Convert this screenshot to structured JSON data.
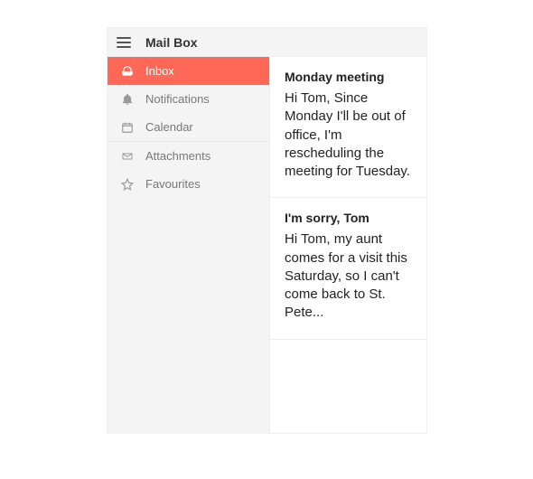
{
  "header": {
    "title": "Mail Box"
  },
  "sidebar": {
    "items": [
      {
        "label": "Inbox",
        "icon": "inbox-icon",
        "active": true
      },
      {
        "label": "Notifications",
        "icon": "bell-icon",
        "active": false
      },
      {
        "label": "Calendar",
        "icon": "calendar-icon",
        "active": false
      },
      {
        "label": "Attachments",
        "icon": "attachment-icon",
        "active": false
      },
      {
        "label": "Favourites",
        "icon": "star-icon",
        "active": false
      }
    ]
  },
  "mails": [
    {
      "subject": "Monday meeting",
      "preview": "Hi Tom, Since Monday I'll be out of office, I'm rescheduling the meeting for Tuesday."
    },
    {
      "subject": "I'm sorry, Tom",
      "preview": "Hi Tom, my aunt comes for a visit this Saturday, so I can't come back to St. Pete..."
    }
  ],
  "colors": {
    "accent": "#ff6757"
  }
}
